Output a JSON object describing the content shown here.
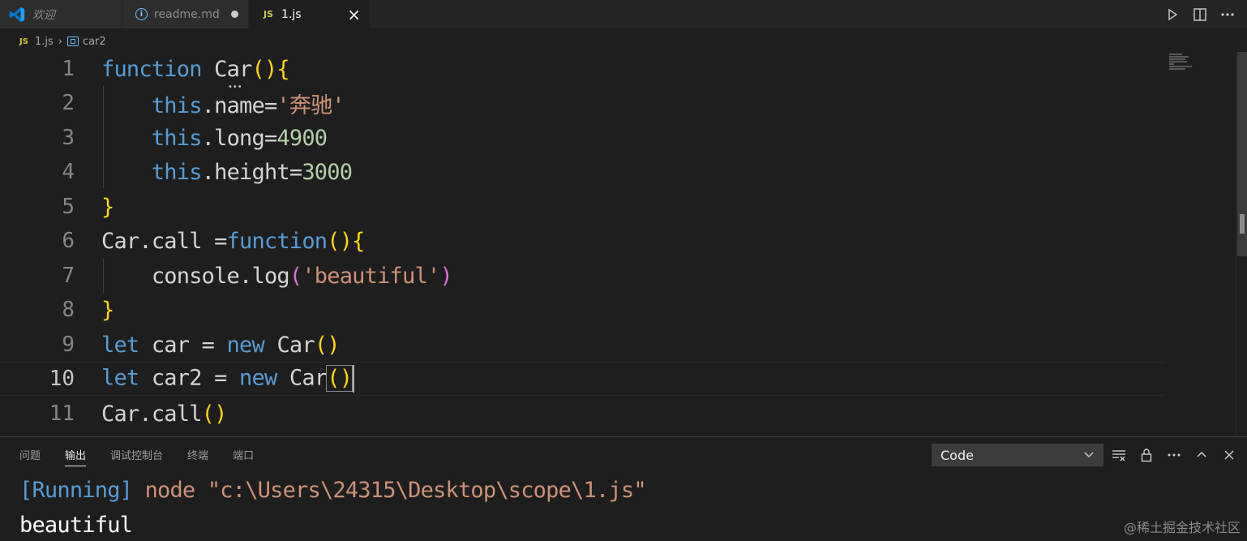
{
  "tabs": [
    {
      "label": "欢迎"
    },
    {
      "label": "readme.md"
    },
    {
      "badge": "JS",
      "label": "1.js"
    }
  ],
  "breadcrumb": {
    "badge": "JS",
    "file": "1.js",
    "symbol": "car2"
  },
  "editor": {
    "line_numbers": [
      "1",
      "2",
      "3",
      "4",
      "5",
      "6",
      "7",
      "8",
      "9",
      "10",
      "11"
    ],
    "current_line": "10",
    "code_lines": [
      "function Car(){",
      "    this.name='奔驰'",
      "    this.long=4900",
      "    this.height=3000",
      "}",
      "Car.call =function(){",
      "    console.log('beautiful')",
      "}",
      "let car = new Car()",
      "let car2 = new Car()",
      "Car.call()"
    ]
  },
  "panel": {
    "tabs": [
      "问题",
      "输出",
      "调试控制台",
      "终端",
      "端口"
    ],
    "active_tab": "输出",
    "output_channel": "Code",
    "output_lines": [
      "[Running] node \"c:\\Users\\24315\\Desktop\\scope\\1.js\"",
      "beautiful"
    ]
  },
  "watermark": "@稀土掘金技术社区",
  "colors": {
    "keyword": "#569cd6",
    "string": "#ce9178",
    "number": "#b5cea8",
    "bracket_gold": "#ffd700",
    "bracket_purple": "#da70d6",
    "js_badge": "#cbcb41"
  }
}
